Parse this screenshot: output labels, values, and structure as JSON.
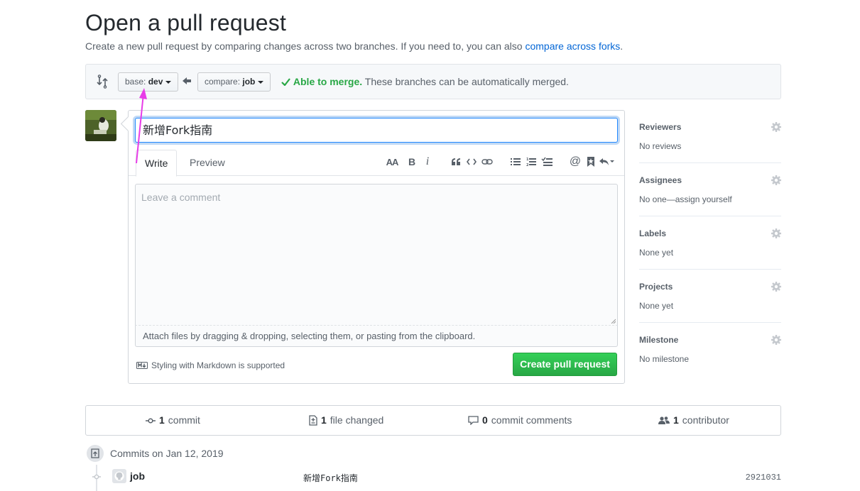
{
  "header": {
    "title": "Open a pull request",
    "subtitle_prefix": "Create a new pull request by comparing changes across two branches. If you need to, you can also ",
    "subtitle_link": "compare across forks",
    "subtitle_suffix": "."
  },
  "range": {
    "base_label": "base:",
    "base_value": "dev",
    "compare_label": "compare:",
    "compare_value": "job",
    "merge_status": "Able to merge.",
    "merge_detail": "These branches can be automatically merged."
  },
  "composer": {
    "title_value": "新增Fork指南",
    "tab_write": "Write",
    "tab_preview": "Preview",
    "comment_placeholder": "Leave a comment",
    "attach_note": "Attach files by dragging & dropping, selecting them, or pasting from the clipboard.",
    "markdown_note": "Styling with Markdown is supported",
    "submit_label": "Create pull request",
    "toolbar_icons": [
      "header-icon",
      "bold-icon",
      "italic-icon",
      "quote-icon",
      "code-icon",
      "link-icon",
      "unordered-list-icon",
      "ordered-list-icon",
      "task-list-icon",
      "mention-icon",
      "bookmark-icon",
      "reply-icon"
    ],
    "toolbar_labels": {
      "header": "AA",
      "bold": "B",
      "italic": "i",
      "mention": "@"
    }
  },
  "sidebar": {
    "items": [
      {
        "title": "Reviewers",
        "value": "No reviews"
      },
      {
        "title": "Assignees",
        "value": "No one—assign yourself"
      },
      {
        "title": "Labels",
        "value": "None yet"
      },
      {
        "title": "Projects",
        "value": "None yet"
      },
      {
        "title": "Milestone",
        "value": "No milestone"
      }
    ]
  },
  "stats": {
    "commits_count": "1",
    "commits_label": "commit",
    "files_count": "1",
    "files_label": "file changed",
    "comments_count": "0",
    "comments_label": "commit comments",
    "contributors_count": "1",
    "contributors_label": "contributor"
  },
  "commits": {
    "heading": "Commits on Jan 12, 2019",
    "rows": [
      {
        "author": "job",
        "message": "新增Fork指南",
        "sha": "2921031"
      }
    ]
  },
  "colors": {
    "accent": "#0366d6",
    "success": "#28a745",
    "annotation_arrow": "#e83ce8"
  }
}
